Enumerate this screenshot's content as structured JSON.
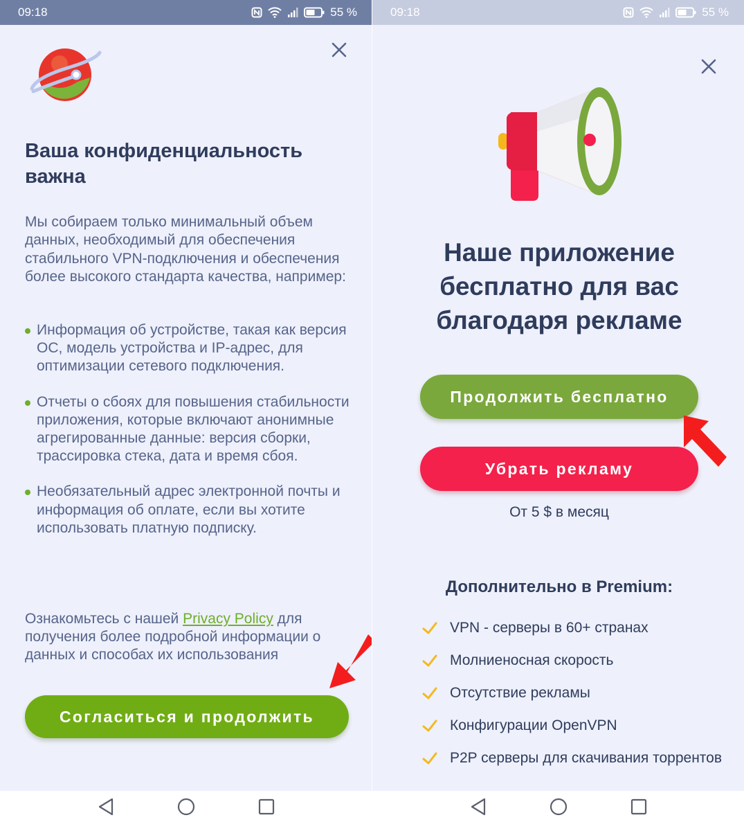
{
  "status_left": {
    "time": "09:18",
    "battery": "55 %"
  },
  "status_right": {
    "time": "09:18",
    "battery": "55 %"
  },
  "left": {
    "title": "Ваша конфиденциальность важна",
    "intro": "Мы собираем только минимальный объем данных, необходимый для обеспечения стабильного VPN-подключения и обеспечения более высокого стандарта качества, например:",
    "bullets": [
      "Информация об устройстве, такая как версия ОС, модель устройства и IP-адрес, для оптимизации сетевого подключения.",
      "Отчеты о сбоях для повышения стабильности приложения, которые включают анонимные агрегированные данные: версия сборки, трассировка стека, дата и время сбоя.",
      "Необязательный адрес электронной почты и информация об оплате, если вы хотите использовать платную подписку."
    ],
    "privacy_prefix": "Ознакомьтесь с нашей ",
    "privacy_link": "Privacy Policy",
    "privacy_suffix": " для получения более подробной информации о данных и способах их использования",
    "agree_button": "Согласиться и продолжить"
  },
  "right": {
    "title": "Наше приложение бесплатно для вас благодаря рекламе",
    "continue_free_button": "Продолжить бесплатно",
    "remove_ads_button": "Убрать рекламу",
    "price": "От 5 $ в месяц",
    "premium_title": "Дополнительно в Premium:",
    "features": [
      "VPN - серверы в 60+ странах",
      "Молниеносная скорость",
      "Отсутствие рекламы",
      "Конфигурации OpenVPN",
      "P2P серверы для скачивания торрентов"
    ]
  },
  "colors": {
    "accent_green": "#70ad14",
    "accent_red": "#f3214b",
    "text_dark": "#2f3c5c",
    "text_muted": "#56648a"
  },
  "icons": [
    "nfc-icon",
    "wifi-icon",
    "signal-icon",
    "battery-icon",
    "close-icon",
    "logo-planet-icon",
    "megaphone-icon",
    "check-icon",
    "red-arrow-icon",
    "back-icon",
    "home-icon",
    "recents-icon"
  ]
}
